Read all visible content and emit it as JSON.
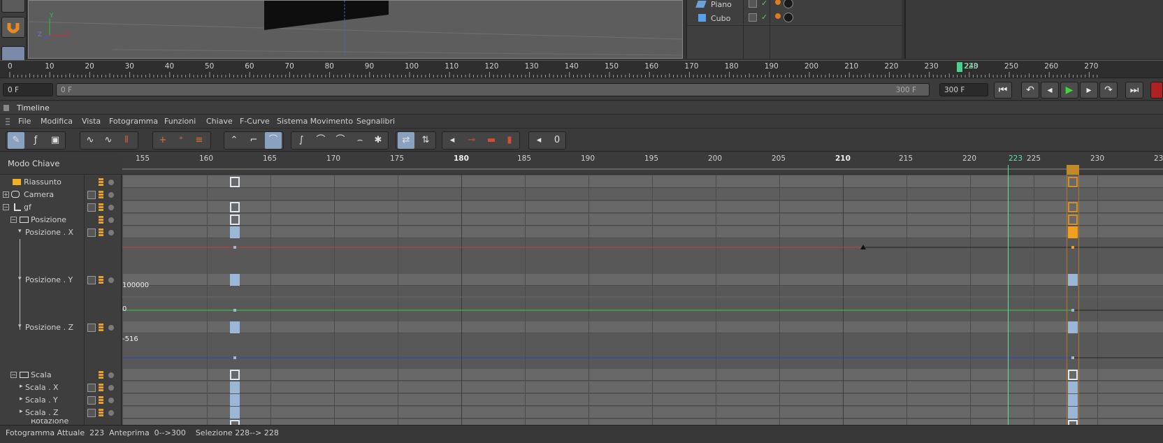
{
  "viewport": {
    "axis_x": "X",
    "axis_y": "Y",
    "axis_z": "Z"
  },
  "object_manager": {
    "items": [
      {
        "label": "Piano"
      },
      {
        "label": "Cubo"
      }
    ]
  },
  "main_ruler": {
    "ticks": [
      "0",
      "10",
      "20",
      "30",
      "40",
      "50",
      "60",
      "70",
      "80",
      "90",
      "100",
      "110",
      "120",
      "130",
      "140",
      "150",
      "160",
      "170",
      "180",
      "190",
      "200",
      "210",
      "220",
      "230",
      "240",
      "250",
      "260",
      "270"
    ],
    "current": "223"
  },
  "transport": {
    "start_field": "0 F",
    "range_left": "0 F",
    "range_right": "300 F",
    "end_field": "300 F"
  },
  "timeline": {
    "title": "Timeline",
    "menu": [
      "File",
      "Modifica",
      "Vista",
      "Fotogramma",
      "Funzioni",
      "Chiave",
      "F-Curve",
      "Sistema Movimento",
      "Segnalibri"
    ],
    "mode_label": "Modo Chiave",
    "ruler_ticks": [
      "155",
      "160",
      "165",
      "170",
      "175",
      "180",
      "185",
      "190",
      "195",
      "200",
      "205",
      "210",
      "215",
      "220",
      "223",
      "225",
      "230",
      "23"
    ],
    "channels": [
      {
        "label": "Riassunto"
      },
      {
        "label": "Camera"
      },
      {
        "label": "gf"
      },
      {
        "label": "Posizione"
      },
      {
        "label": "Posizione . X"
      },
      {
        "label": "Posizione . Y"
      },
      {
        "label": "Posizione . Z"
      },
      {
        "label": "Scala"
      },
      {
        "label": "Scala . X"
      },
      {
        "label": "Scala . Y"
      },
      {
        "label": "Scala . Z"
      },
      {
        "label": "Rotazione"
      }
    ],
    "curve_labels": {
      "y_top": "100000",
      "y_zero": "0",
      "z_value": "-516"
    }
  },
  "status": {
    "text": "Fotogramma Attuale  223  Anteprima  0-->300    Selezione 228--> 228"
  },
  "colors": {
    "accent": "#8aa2c0",
    "key_orange": "#f0a020",
    "curve_x": "#d03a2a",
    "curve_y": "#3acb3a",
    "curve_z": "#2f43d8",
    "playhead": "#5fe0a0"
  }
}
